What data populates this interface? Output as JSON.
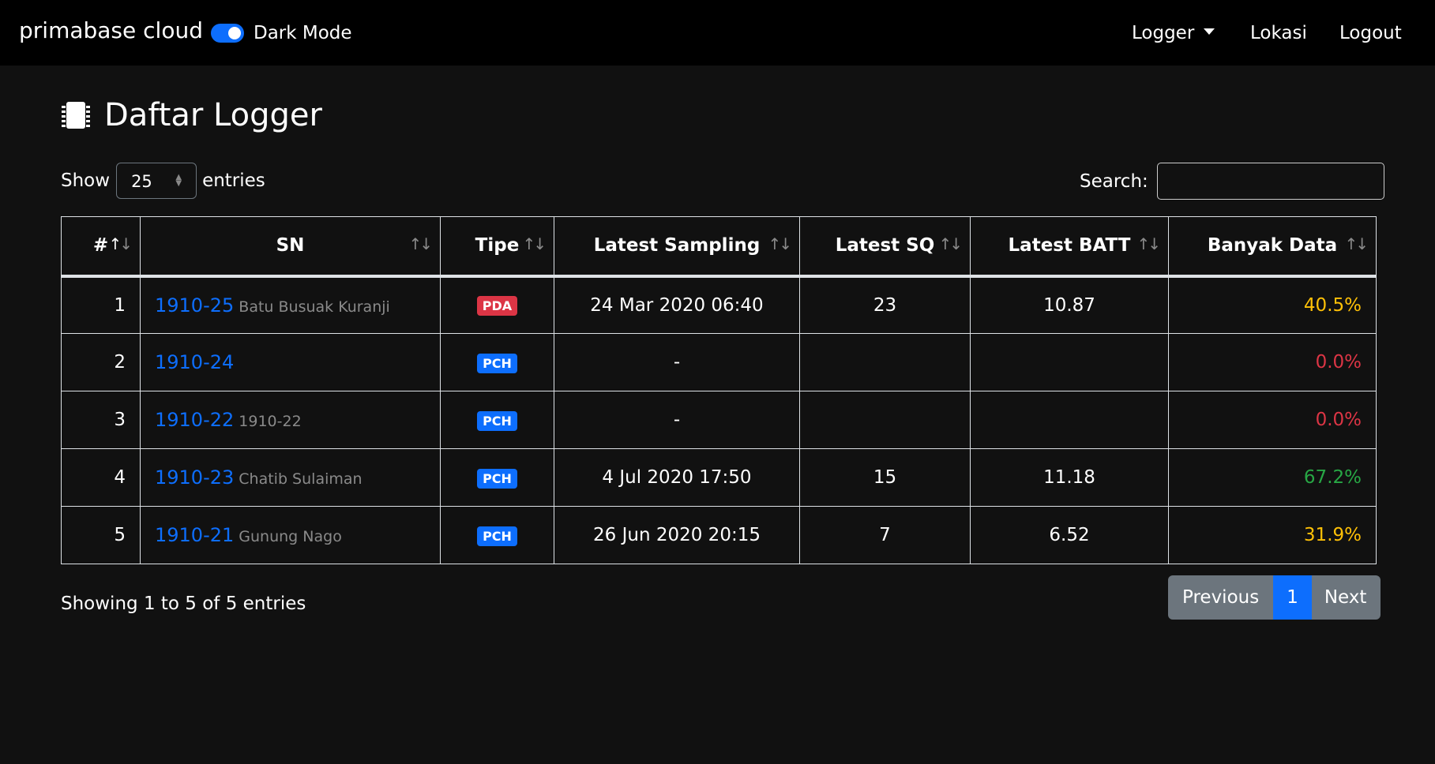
{
  "navbar": {
    "brand": "primabase cloud",
    "dark_mode_label": "Dark Mode",
    "dark_mode_on": true,
    "menu": [
      {
        "label": "Logger"
      },
      {
        "label": "Lokasi"
      },
      {
        "label": "Logout"
      }
    ]
  },
  "page": {
    "title": "Daftar Logger",
    "icon": "chip-icon"
  },
  "controls": {
    "show_label": "Show",
    "entries_value": "25",
    "entries_label": "entries",
    "search_label": "Search:",
    "search_value": ""
  },
  "table": {
    "columns": [
      "#",
      "SN",
      "Tipe",
      "Latest Sampling",
      "Latest SQ",
      "Latest BATT",
      "Banyak Data"
    ],
    "rows": [
      {
        "no": "1",
        "sn": "1910-25",
        "desc": "Batu Busuak Kuranji",
        "tipe": "PDA",
        "sampling": "24 Mar 2020 06:40",
        "sq": "23",
        "batt": "10.87",
        "data": "40.5%"
      },
      {
        "no": "2",
        "sn": "1910-24",
        "desc": "",
        "tipe": "PCH",
        "sampling": "-",
        "sq": "",
        "batt": "",
        "data": "0.0%"
      },
      {
        "no": "3",
        "sn": "1910-22",
        "desc": "1910-22",
        "tipe": "PCH",
        "sampling": "-",
        "sq": "",
        "batt": "",
        "data": "0.0%"
      },
      {
        "no": "4",
        "sn": "1910-23",
        "desc": "Chatib Sulaiman",
        "tipe": "PCH",
        "sampling": "4 Jul 2020 17:50",
        "sq": "15",
        "batt": "11.18",
        "data": "67.2%"
      },
      {
        "no": "5",
        "sn": "1910-21",
        "desc": "Gunung Nago",
        "tipe": "PCH",
        "sampling": "26 Jun 2020 20:15",
        "sq": "7",
        "batt": "6.52",
        "data": "31.9%"
      }
    ]
  },
  "footer": {
    "info": "Showing 1 to 5 of 5 entries",
    "pagination": {
      "previous": "Previous",
      "current": "1",
      "next": "Next"
    }
  },
  "colors": {
    "background": "#111111",
    "navbar": "#000000",
    "accent": "#0d6efd",
    "danger": "#dc3545",
    "warning": "#ffc107",
    "success": "#28a745"
  }
}
